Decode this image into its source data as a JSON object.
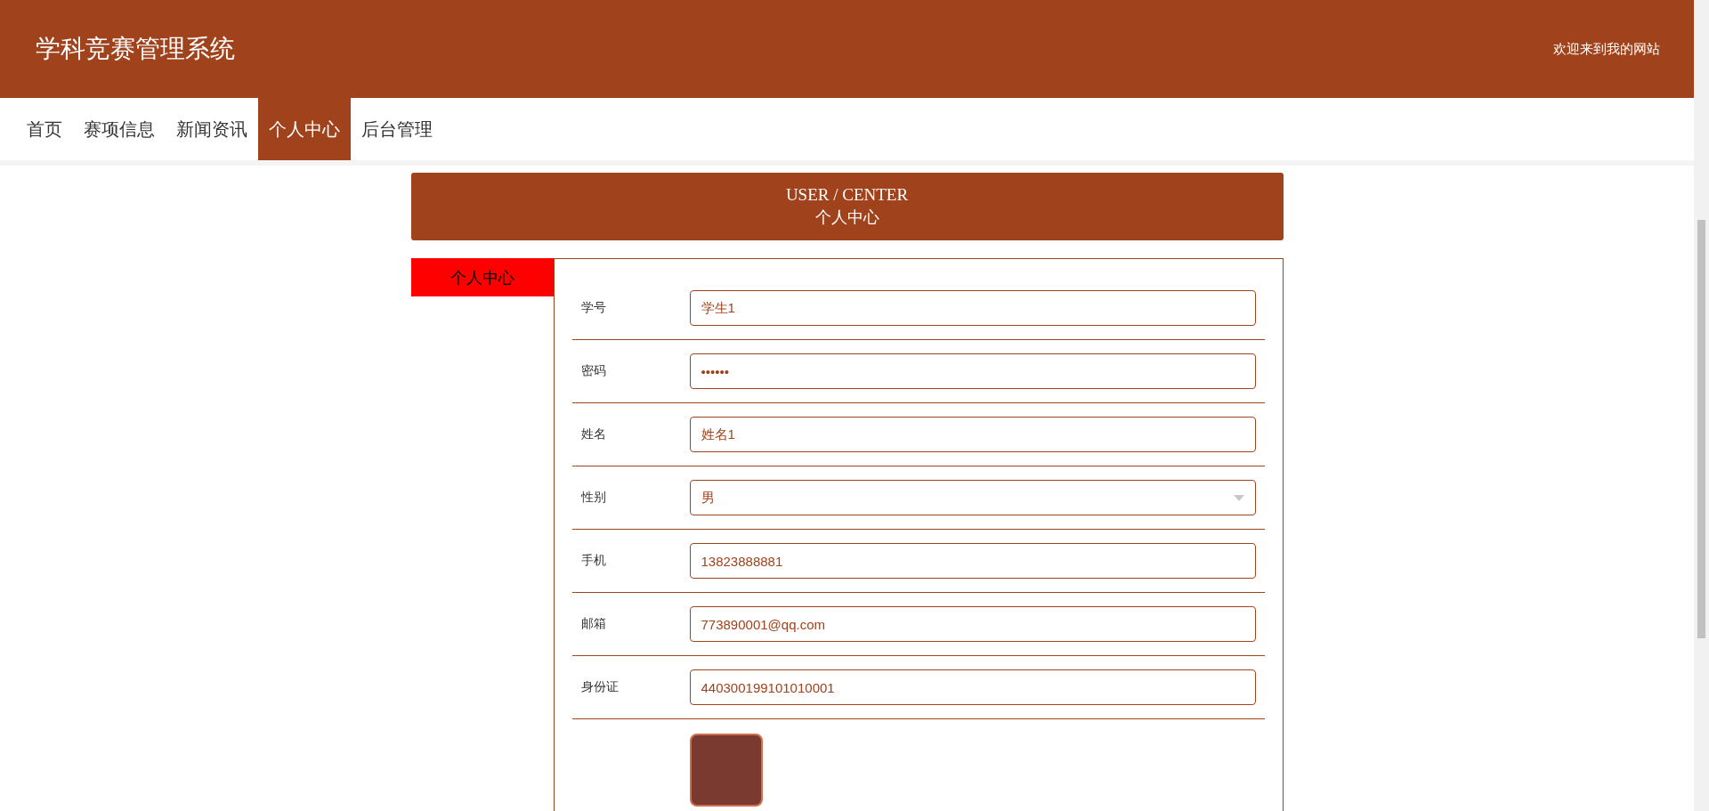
{
  "header": {
    "title": "学科竞赛管理系统",
    "welcome": "欢迎来到我的网站"
  },
  "nav": [
    {
      "label": "首页",
      "selected": false
    },
    {
      "label": "赛项信息",
      "selected": false
    },
    {
      "label": "新闻资讯",
      "selected": false
    },
    {
      "label": "个人中心",
      "selected": true
    },
    {
      "label": "后台管理",
      "selected": false
    }
  ],
  "banner": {
    "title": "USER / CENTER",
    "subtitle": "个人中心"
  },
  "sidebar": [
    {
      "label": "个人中心",
      "selected": true
    }
  ],
  "form": [
    {
      "kind": "text",
      "label": "学号",
      "value": "学生1"
    },
    {
      "kind": "text",
      "label": "密码",
      "value": "••••••"
    },
    {
      "kind": "text",
      "label": "姓名",
      "value": "姓名1"
    },
    {
      "kind": "select",
      "label": "性别",
      "value": "男"
    },
    {
      "kind": "text",
      "label": "手机",
      "value": "13823888881"
    },
    {
      "kind": "text",
      "label": "邮箱",
      "value": "773890001@qq.com"
    },
    {
      "kind": "text",
      "label": "身份证",
      "value": "440300199101010001"
    },
    {
      "kind": "photo"
    }
  ]
}
